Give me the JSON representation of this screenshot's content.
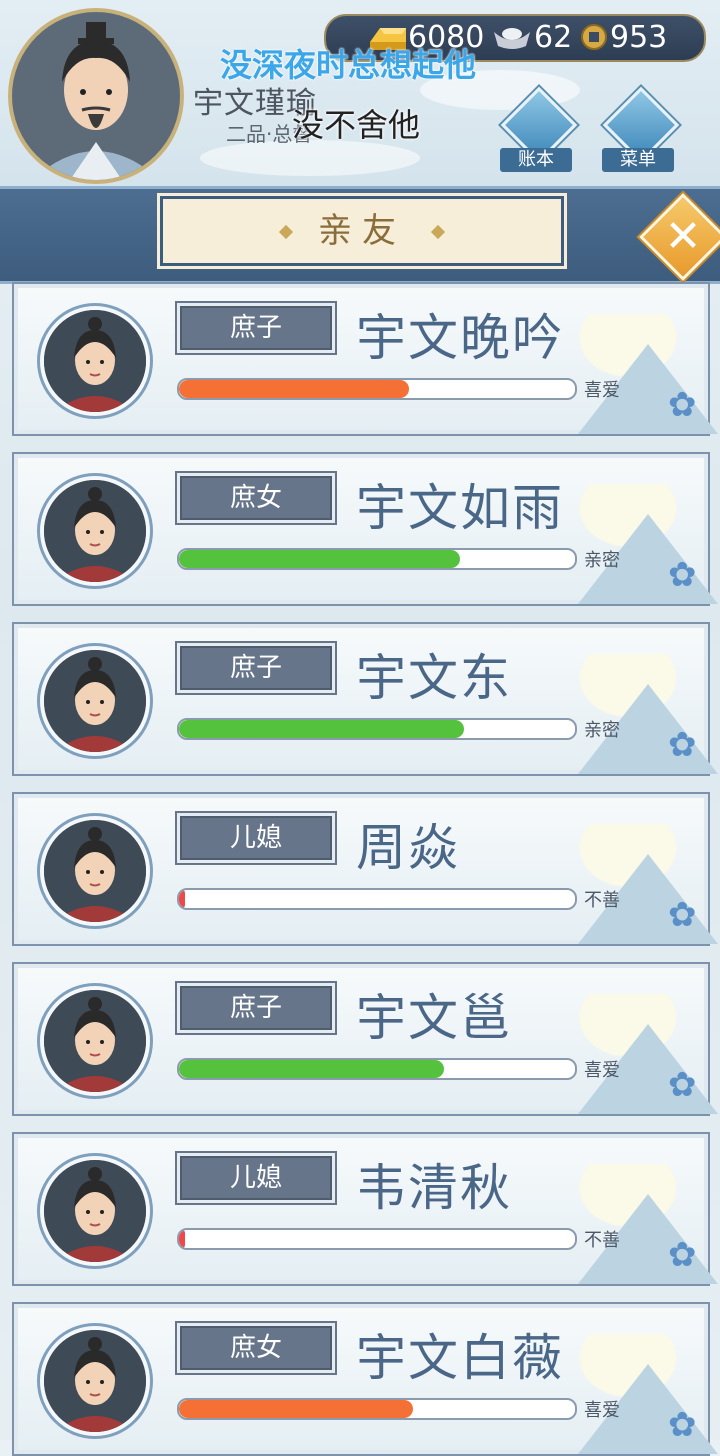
{
  "header": {
    "player_name": "宇文瑾瑜",
    "player_rank": "二品·总督",
    "overlay_top": "没深夜时总想起他",
    "overlay_bottom": "没不舍他",
    "gold": "6080",
    "silver": "62",
    "copper": "953",
    "ledger_label": "账本",
    "menu_label": "菜单"
  },
  "title": "亲友",
  "relatives": [
    {
      "tag": "庶子",
      "name": "宇文晚吟",
      "affection": 0.58,
      "bar_color": "#f47035",
      "relation": "喜爱"
    },
    {
      "tag": "庶女",
      "name": "宇文如雨",
      "affection": 0.71,
      "bar_color": "#55c23d",
      "relation": "亲密"
    },
    {
      "tag": "庶子",
      "name": "宇文东",
      "affection": 0.72,
      "bar_color": "#55c23d",
      "relation": "亲密"
    },
    {
      "tag": "儿媳",
      "name": "周焱",
      "affection": 0.01,
      "bar_color": "#f04848",
      "relation": "不善"
    },
    {
      "tag": "庶子",
      "name": "宇文邕",
      "affection": 0.67,
      "bar_color": "#55c23d",
      "relation": "喜爱"
    },
    {
      "tag": "儿媳",
      "name": "韦清秋",
      "affection": 0.01,
      "bar_color": "#f04848",
      "relation": "不善"
    },
    {
      "tag": "庶女",
      "name": "宇文白薇",
      "affection": 0.59,
      "bar_color": "#f47035",
      "relation": "喜爱"
    }
  ]
}
